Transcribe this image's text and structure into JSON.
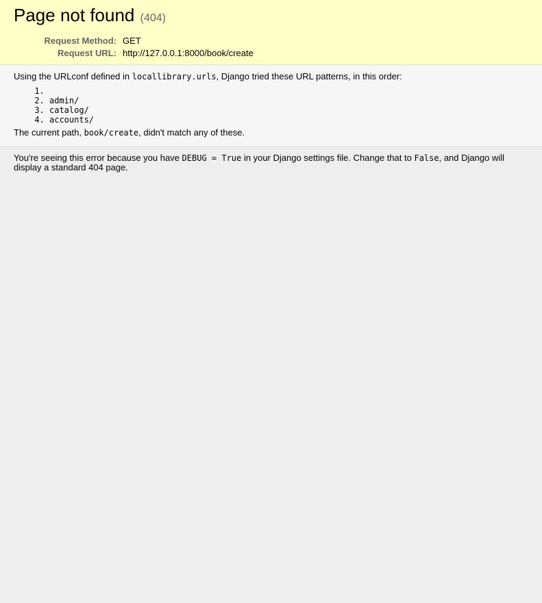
{
  "summary": {
    "title": "Page not found",
    "status_code": "(404)",
    "meta": [
      {
        "label": "Request Method:",
        "value": "GET"
      },
      {
        "label": "Request URL:",
        "value": "http://127.0.0.1:8000/book/create"
      }
    ]
  },
  "info": {
    "intro_before": "Using the URLconf defined in ",
    "urlconf": "locallibrary.urls",
    "intro_after": ", Django tried these URL patterns, in this order:",
    "patterns": [
      "",
      "admin/",
      "catalog/",
      "accounts/"
    ],
    "current_before": "The current path, ",
    "current_path": "book/create",
    "current_after": ", didn't match any of these."
  },
  "explanation": {
    "part1": "You're seeing this error because you have ",
    "debug_code": "DEBUG = True",
    "part2": " in your Django settings file. Change that to ",
    "false_code": "False",
    "part3": ", and Django will display a standard 404 page."
  },
  "colors": {
    "summary_bg": "#ffffc8",
    "info_bg": "#f6f6f6",
    "page_bg": "#eeeeee",
    "label_gray": "#666666"
  }
}
